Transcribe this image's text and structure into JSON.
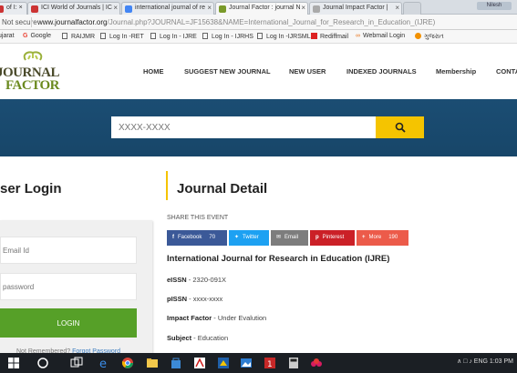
{
  "browser": {
    "tabs": [
      {
        "label": "of I: ×",
        "color": "#c33"
      },
      {
        "label": "ICI World of Journals | IC",
        "color": "#c33"
      },
      {
        "label": "international journal of re",
        "color": "#4285f4"
      },
      {
        "label": "Journal Factor : journal N",
        "color": "#7a9a2a"
      },
      {
        "label": "Journal Impact Factor |",
        "color": "#888"
      }
    ],
    "user_badge": "Nilesh",
    "security": "Not secure",
    "url_host": "www.journalfactor.org",
    "url_path": "/Journal.php?JOURNAL=JF15638&NAME=International_Journal_for_Research_in_Education_(IJRE)",
    "bookmarks": [
      {
        "label": "ujarat",
        "icon": "folder-icon"
      },
      {
        "label": "Google",
        "icon": "google-icon"
      },
      {
        "label": "RAIJMR",
        "icon": "page-icon"
      },
      {
        "label": "Log In -RET",
        "icon": "page-icon"
      },
      {
        "label": "Log In - IJRE",
        "icon": "page-icon"
      },
      {
        "label": "Log In - IJRHS",
        "icon": "page-icon"
      },
      {
        "label": "Log In -IJRSML",
        "icon": "page-icon"
      },
      {
        "label": "Rediffmail",
        "icon": "rediff-icon"
      },
      {
        "label": "Webmail Login",
        "icon": "webmail-icon"
      },
      {
        "label": "ગુજરાત",
        "icon": "gujarati-icon"
      }
    ]
  },
  "site": {
    "logo_top": "JOURNAL",
    "logo_bottom": "FACTOR",
    "nav": [
      "HOME",
      "SUGGEST NEW JOURNAL",
      "NEW USER",
      "INDEXED JOURNALS",
      "Membership",
      "CONTA"
    ]
  },
  "search": {
    "placeholder": "XXXX-XXXX"
  },
  "login": {
    "title": "ser Login",
    "email_placeholder": "Email Id",
    "password_placeholder": "password",
    "button": "LOGIN",
    "forgot_prefix": "Not Remembered?",
    "forgot_link": "Forgot Password"
  },
  "detail": {
    "title": "Journal Detail",
    "share_label": "SHARE THIS EVENT",
    "share_buttons": [
      {
        "label": "Facebook",
        "count": "70",
        "color": "#3b5998"
      },
      {
        "label": "Twitter",
        "count": "",
        "color": "#1da1f2"
      },
      {
        "label": "Email",
        "count": "",
        "color": "#7d7d7d"
      },
      {
        "label": "Pinterest",
        "count": "",
        "color": "#cb2027"
      },
      {
        "label": "More",
        "count": "190",
        "color": "#ec5b4a"
      }
    ],
    "journal_name": "International Journal for Research in Education (IJRE)",
    "fields": [
      {
        "label": "eISSN",
        "value": "2320-091X"
      },
      {
        "label": "pISSN",
        "value": "xxxx-xxxx"
      },
      {
        "label": "Impact Factor",
        "value": "Under Evalution"
      },
      {
        "label": "Subject",
        "value": "Education"
      }
    ]
  },
  "taskbar": {
    "tray": "∧  □  ♪  ENG  1:03 PM"
  }
}
